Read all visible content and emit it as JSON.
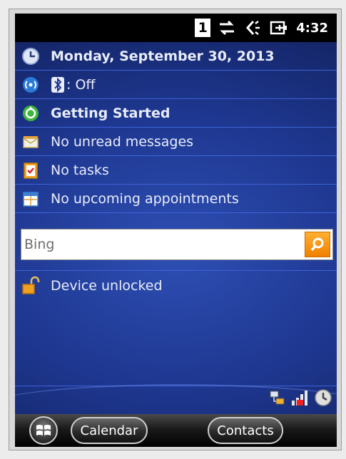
{
  "status_bar": {
    "sim_label": "1",
    "time": "4:32"
  },
  "today": {
    "date": "Monday, September 30, 2013",
    "bluetooth_status": ": Off",
    "getting_started": "Getting Started",
    "messages": "No unread messages",
    "tasks": "No tasks",
    "appointments": "No upcoming appointments"
  },
  "search": {
    "placeholder": "Bing"
  },
  "lock": {
    "status": "Device unlocked"
  },
  "softkeys": {
    "left": "Calendar",
    "right": "Contacts"
  },
  "colors": {
    "search_button": "#f08000",
    "row_divider": "#3e62d8"
  }
}
